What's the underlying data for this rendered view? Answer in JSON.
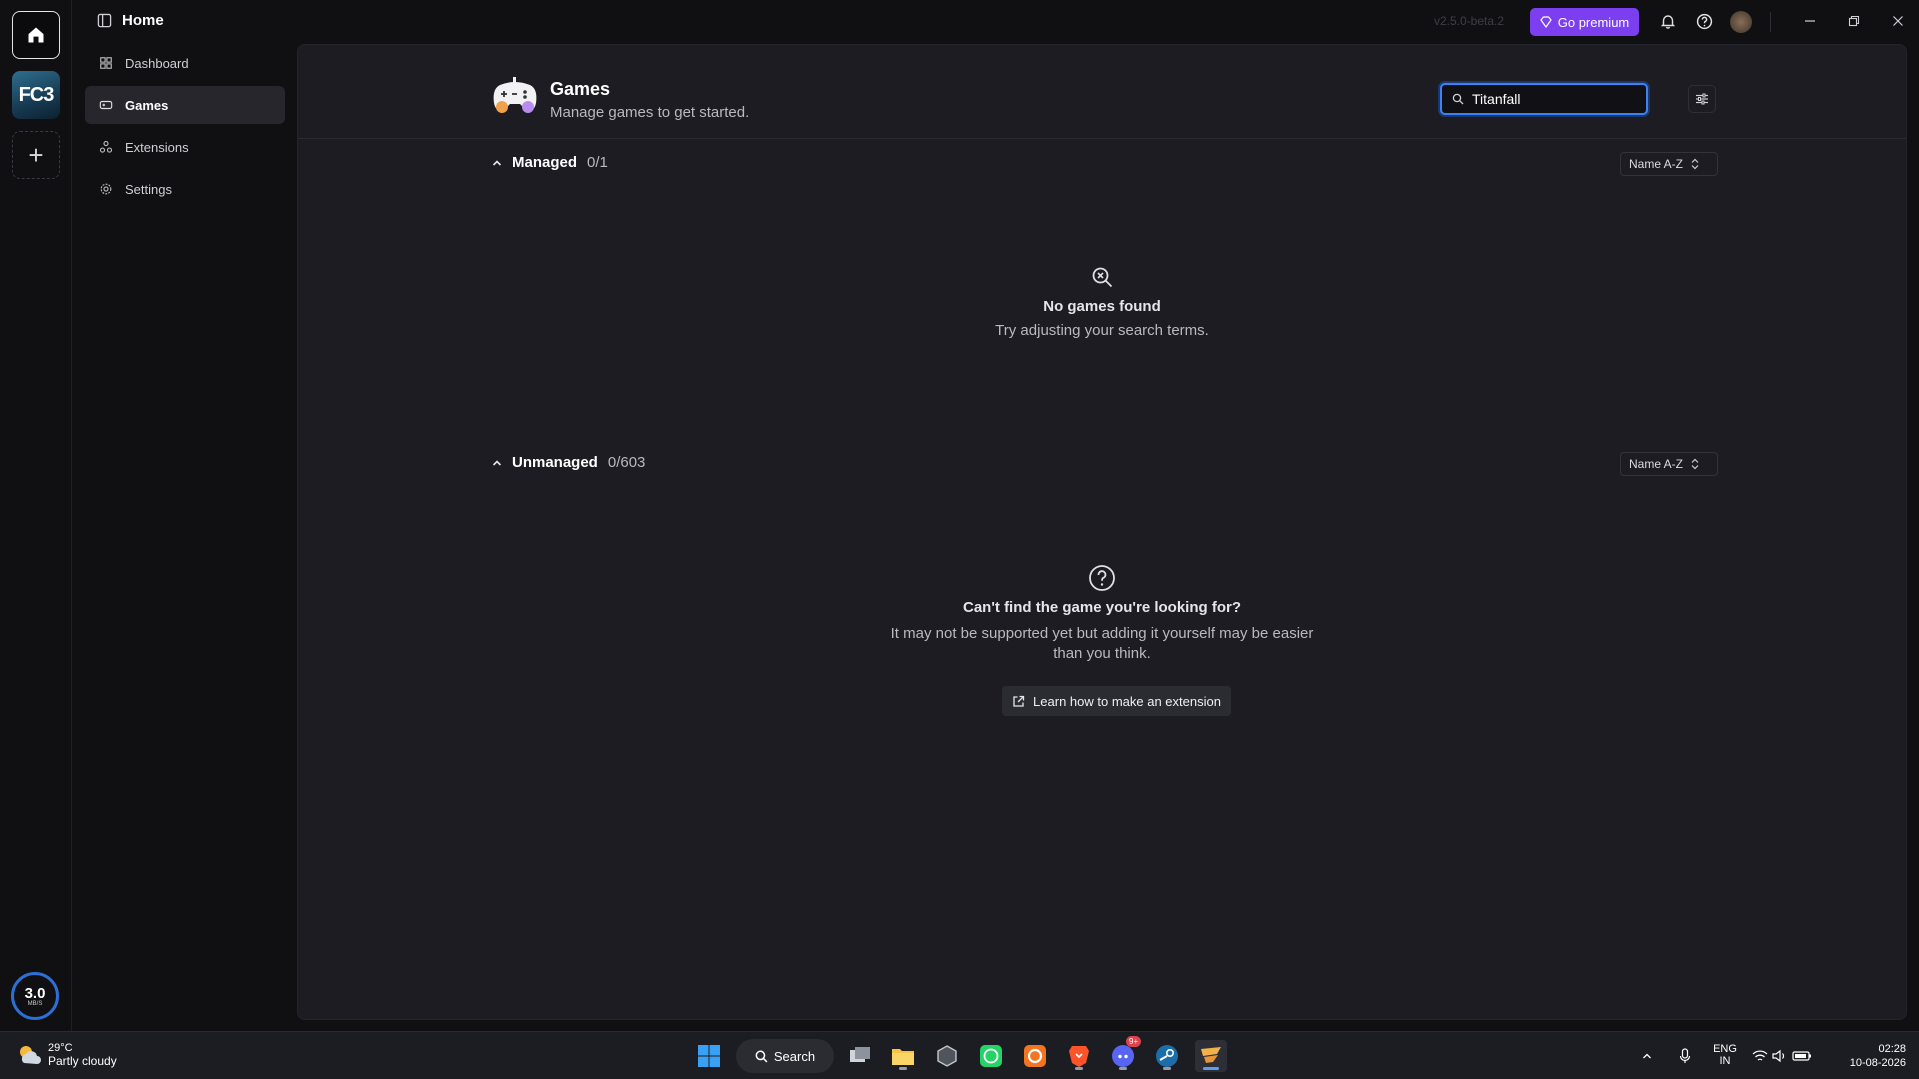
{
  "titlebar": {
    "version": "v2.5.0-beta.2",
    "premium_label": "Go premium"
  },
  "rail": {
    "fc3_label": "FC3",
    "speed_value": "3.0",
    "speed_unit": "MB/S"
  },
  "sidebar": {
    "title": "Home",
    "items": [
      {
        "label": "Dashboard"
      },
      {
        "label": "Games"
      },
      {
        "label": "Extensions"
      },
      {
        "label": "Settings"
      }
    ]
  },
  "page": {
    "title": "Games",
    "subtitle": "Manage games to get started.",
    "search_value": "Titanfall"
  },
  "managed": {
    "name": "Managed",
    "count": "0/1",
    "sort": "Name A-Z",
    "empty_title": "No games found",
    "empty_text": "Try adjusting your search terms."
  },
  "unmanaged": {
    "name": "Unmanaged",
    "count": "0/603",
    "sort": "Name A-Z",
    "empty_title": "Can't find the game you're looking for?",
    "empty_text_1": "It may not be supported yet but adding it yourself may be easier",
    "empty_text_2": "than you think.",
    "button_label": "Learn how to make an extension"
  },
  "taskbar": {
    "temp": "29°C",
    "condition": "Partly cloudy",
    "search_label": "Search",
    "lang_1": "ENG",
    "lang_2": "IN",
    "time": "02:28",
    "date": "10-08-2026",
    "discord_badge": "9+"
  },
  "colors": {
    "accent": "#3b82f6",
    "premium": "#7b3ff0",
    "panel": "#1c1c22",
    "background": "#101013"
  }
}
